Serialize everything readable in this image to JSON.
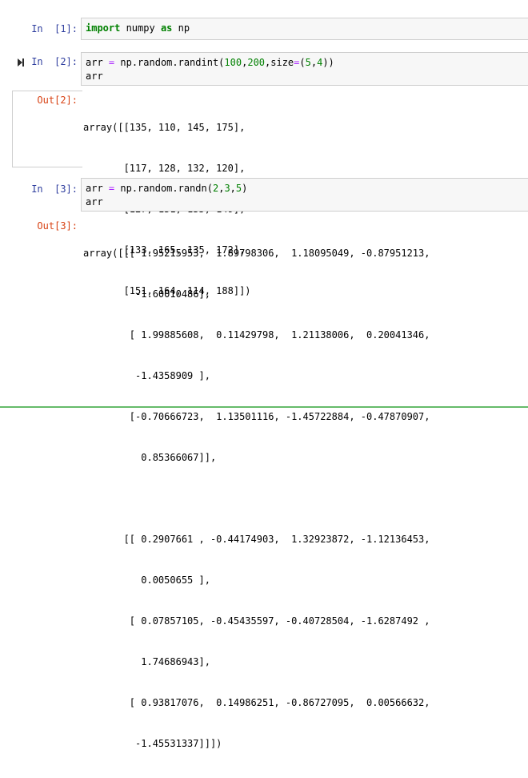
{
  "cells": [
    {
      "in_prompt": "In  [1]:",
      "code": [
        [
          {
            "t": "kw",
            "v": "import"
          },
          {
            "t": "plain",
            "v": " numpy "
          },
          {
            "t": "kw",
            "v": "as"
          },
          {
            "t": "plain",
            "v": " np"
          }
        ]
      ]
    },
    {
      "in_prompt": "In  [2]:",
      "code": [
        [
          {
            "t": "plain",
            "v": "arr "
          },
          {
            "t": "op",
            "v": "="
          },
          {
            "t": "plain",
            "v": " np.random.randint("
          },
          {
            "t": "num",
            "v": "100"
          },
          {
            "t": "plain",
            "v": ","
          },
          {
            "t": "num",
            "v": "200"
          },
          {
            "t": "plain",
            "v": ",size"
          },
          {
            "t": "op",
            "v": "="
          },
          {
            "t": "plain",
            "v": "("
          },
          {
            "t": "num",
            "v": "5"
          },
          {
            "t": "plain",
            "v": ","
          },
          {
            "t": "num",
            "v": "4"
          },
          {
            "t": "plain",
            "v": "))"
          }
        ],
        [
          {
            "t": "plain",
            "v": "arr"
          }
        ]
      ],
      "out_prompt": "Out[2]:",
      "output": [
        "array([[135, 110, 145, 175],",
        "       [117, 128, 132, 120],",
        "       [127, 151, 135, 149],",
        "       [133, 165, 135, 172],",
        "       [151, 164, 114, 188]])"
      ]
    },
    {
      "in_prompt": "In  [3]:",
      "code": [
        [
          {
            "t": "plain",
            "v": "arr "
          },
          {
            "t": "op",
            "v": "="
          },
          {
            "t": "plain",
            "v": " np.random.randn("
          },
          {
            "t": "num",
            "v": "2"
          },
          {
            "t": "plain",
            "v": ","
          },
          {
            "t": "num",
            "v": "3"
          },
          {
            "t": "plain",
            "v": ","
          },
          {
            "t": "num",
            "v": "5"
          },
          {
            "t": "plain",
            "v": ")"
          }
        ],
        [
          {
            "t": "plain",
            "v": "arr"
          }
        ]
      ],
      "out_prompt": "Out[3]:",
      "output": [
        "array([[[ 1.95215953,  1.89798306,  1.18095049, -0.87951213,",
        "         -1.60010486],",
        "        [ 1.99885608,  0.11429798,  1.21138006,  0.20041346,",
        "         -1.4358909 ],",
        "        [-0.70666723,  1.13501116, -1.45722884, -0.47870907,",
        "          0.85366067]],",
        "",
        "       [[ 0.2907661 , -0.44174903,  1.32923872, -1.12136453,",
        "          0.0050655 ],",
        "        [ 0.07857105, -0.45435597, -0.40728504, -1.6287492 ,",
        "          1.74686943],",
        "        [ 0.93817076,  0.14986251, -0.86727095,  0.00566632,",
        "         -1.45531337]]])"
      ]
    }
  ],
  "colors": {
    "in_prompt": "#303f9f",
    "out_prompt": "#d84315",
    "keyword": "#008000",
    "operator": "#aa22ff",
    "number": "#008000",
    "input_bg": "#f7f7f7",
    "input_border": "#cfcfcf",
    "selected_cell_border": "#66bb6a"
  },
  "icons": {
    "run": "run-cell-icon"
  }
}
